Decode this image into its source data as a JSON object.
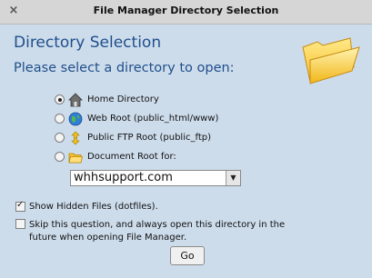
{
  "window": {
    "title": "File Manager Directory Selection",
    "close_glyph": "×"
  },
  "dialog": {
    "heading": "Directory Selection",
    "subheading": "Please select a directory to open:"
  },
  "options": [
    {
      "label": "Home Directory",
      "icon": "home-icon",
      "selected": true
    },
    {
      "label": "Web Root (public_html/www)",
      "icon": "globe-icon",
      "selected": false
    },
    {
      "label": "Public FTP Root (public_ftp)",
      "icon": "ftp-icon",
      "selected": false
    },
    {
      "label": "Document Root for:",
      "icon": "folder-icon",
      "selected": false
    }
  ],
  "domain_select": {
    "value": "whhsupport.com",
    "arrow": "▼"
  },
  "show_hidden": {
    "label": "Show Hidden Files (dotfiles).",
    "checked": true
  },
  "skip_question": {
    "label": "Skip this question, and always open this directory in the future when opening File Manager.",
    "checked": false
  },
  "go_button": {
    "label": "Go"
  }
}
